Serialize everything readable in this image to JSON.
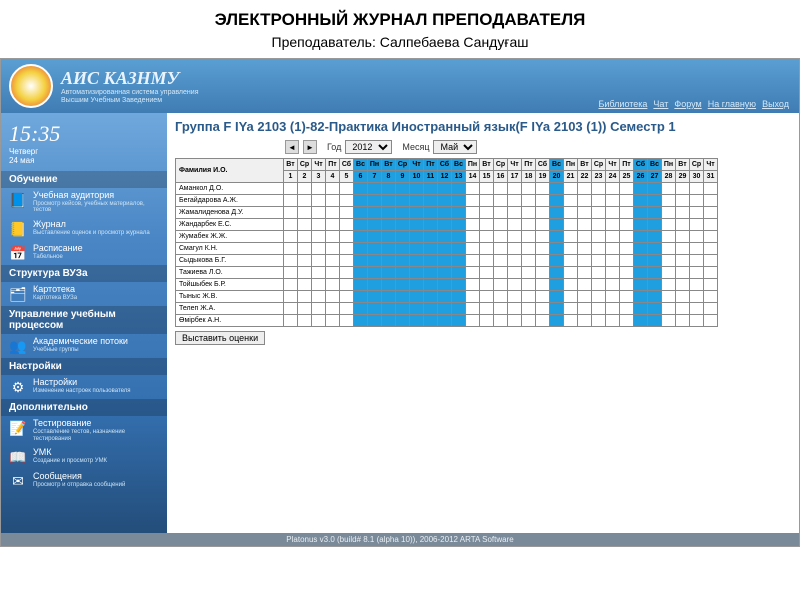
{
  "page": {
    "title": "ЭЛЕКТРОННЫЙ ЖУРНАЛ ПРЕПОДАВАТЕЛЯ",
    "subtitle_prefix": "Преподаватель: ",
    "teacher": "Салпебаева Сандуғаш"
  },
  "brand": {
    "title": "АИС КАЗНМУ",
    "sub1": "Автоматизированная система управления",
    "sub2": "Высшим Учебным Заведением"
  },
  "toplinks": [
    "Библиотека",
    "Чат",
    "Форум",
    "На главную",
    "Выход"
  ],
  "clock": {
    "time": "15:35",
    "weekday": "Четверг",
    "date": "24 мая"
  },
  "sidebar": {
    "sections": [
      {
        "header": "Обучение",
        "items": [
          {
            "icon": "📘",
            "label": "Учебная аудитория",
            "desc": "Просмотр кейсов, учебных материалов, тестов"
          },
          {
            "icon": "📒",
            "label": "Журнал",
            "desc": "Выставление оценок и просмотр журнала"
          },
          {
            "icon": "📅",
            "label": "Расписание",
            "desc": "Табельное"
          }
        ]
      },
      {
        "header": "Структура ВУЗа",
        "items": [
          {
            "icon": "🗂",
            "label": "Картотека",
            "desc": "Картотека ВУЗа"
          }
        ]
      },
      {
        "header": "Управление учебным процессом",
        "items": [
          {
            "icon": "👥",
            "label": "Академические потоки",
            "desc": "Учебные группы"
          }
        ]
      },
      {
        "header": "Настройки",
        "items": [
          {
            "icon": "⚙",
            "label": "Настройки",
            "desc": "Изменение настроек пользователя"
          }
        ]
      },
      {
        "header": "Дополнительно",
        "items": [
          {
            "icon": "📝",
            "label": "Тестирование",
            "desc": "Составление тестов, назначение тестирования"
          },
          {
            "icon": "📖",
            "label": "УМК",
            "desc": "Создание и просмотр УМК"
          },
          {
            "icon": "✉",
            "label": "Сообщения",
            "desc": "Просмотр и отправка сообщений"
          }
        ]
      }
    ]
  },
  "main": {
    "group_title": "Группа F IYa 2103 (1)-82-Практика Иностранный язык(F IYa 2103 (1)) Семестр 1",
    "year_label": "Год",
    "year_value": "2012",
    "month_label": "Месяц",
    "month_value": "Май",
    "name_header": "Фамилия И.О.",
    "weekdays": [
      "Вт",
      "Ср",
      "Чт",
      "Пт",
      "Сб",
      "Вс",
      "Пн",
      "Вт",
      "Ср",
      "Чт",
      "Пт",
      "Сб",
      "Вс",
      "Пн",
      "Вт",
      "Ср",
      "Чт",
      "Пт",
      "Сб",
      "Вс",
      "Пн",
      "Вт",
      "Ср",
      "Чт",
      "Пт",
      "Сб",
      "Вс",
      "Пн",
      "Вт",
      "Ср",
      "Чт"
    ],
    "days": [
      "1",
      "2",
      "3",
      "4",
      "5",
      "6",
      "7",
      "8",
      "9",
      "10",
      "11",
      "12",
      "13",
      "14",
      "15",
      "16",
      "17",
      "18",
      "19",
      "20",
      "21",
      "22",
      "23",
      "24",
      "25",
      "26",
      "27",
      "28",
      "29",
      "30",
      "31"
    ],
    "highlight_days": [
      "6",
      "7",
      "8",
      "9",
      "10",
      "11",
      "12",
      "13",
      "20",
      "26",
      "27"
    ],
    "students": [
      "Аманкол Д.О.",
      "Бегайдарова А.Ж.",
      "Жамалиденова Д.У.",
      "Жандарбек Е.С.",
      "Жумабек Ж.Ж.",
      "Смагул К.Н.",
      "Сыдыкова Б.Г.",
      "Тажиева Л.О.",
      "Тойшыбек Б.Р.",
      "Тыныс Ж.В.",
      "Телеп Ж.А.",
      "Өмірбек А.Н."
    ],
    "submit_label": "Выставить оценки"
  },
  "footer": "Platonus v3.0 (build# 8.1 (alpha 10)), 2006-2012 ARTA Software"
}
